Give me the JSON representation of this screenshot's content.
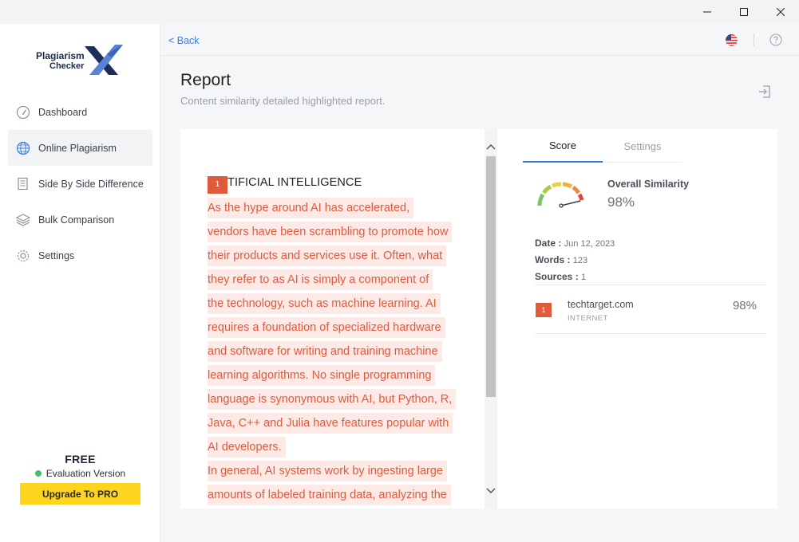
{
  "window": {
    "controls": {
      "minimize": "minimize",
      "maximize": "maximize",
      "close": "close"
    }
  },
  "logo": {
    "line1": "Plagiarism",
    "line2": "Checker",
    "mark": "X"
  },
  "sidebar": {
    "items": [
      {
        "label": "Dashboard",
        "icon": "speedometer-icon",
        "active": false
      },
      {
        "label": "Online Plagiarism",
        "icon": "globe-icon",
        "active": true
      },
      {
        "label": "Side By Side Difference",
        "icon": "document-icon",
        "active": false
      },
      {
        "label": "Bulk Comparison",
        "icon": "layers-icon",
        "active": false
      },
      {
        "label": "Settings",
        "icon": "gear-icon",
        "active": false
      }
    ]
  },
  "plan": {
    "name": "FREE",
    "status": "Evaluation Version",
    "upgrade_label": "Upgrade To PRO"
  },
  "topbar": {
    "back_label": "< Back"
  },
  "header": {
    "title": "Report",
    "subtitle": "Content similarity detailed highlighted report."
  },
  "document": {
    "badge": "1",
    "heading": "TIFICIAL INTELLIGENCE",
    "lines": [
      "As the hype around AI has accelerated,",
      "vendors have been scrambling to promote how",
      "their products and services use it. Often, what",
      "they refer to as AI is simply a component of",
      "the technology, such as machine learning. AI",
      "requires a foundation of specialized hardware",
      "and software for writing and training machine",
      "learning algorithms. No single programming",
      "language is synonymous with AI, but Python, R,",
      "Java, C++ and Julia have features popular with",
      "AI developers.",
      "In general, AI systems work by ingesting large",
      "amounts of labeled training data, analyzing the"
    ]
  },
  "score": {
    "tabs": {
      "score": "Score",
      "settings": "Settings"
    },
    "overall_label": "Overall Similarity",
    "overall_value": "98%",
    "similarity_fraction": 0.98,
    "meta": {
      "date_label": "Date :",
      "date_value": "Jun 12, 2023",
      "words_label": "Words :",
      "words_value": "123",
      "sources_label": "Sources :",
      "sources_value": "1"
    },
    "sources": [
      {
        "badge": "1",
        "domain": "techtarget.com",
        "type": "INTERNET",
        "percent": "98%"
      }
    ]
  },
  "colors": {
    "accent": "#3b7be0",
    "highlight_text": "#e05a3c",
    "highlight_bg": "#fdeae6",
    "upgrade": "#ffd41e",
    "status_green": "#3cc26e"
  }
}
